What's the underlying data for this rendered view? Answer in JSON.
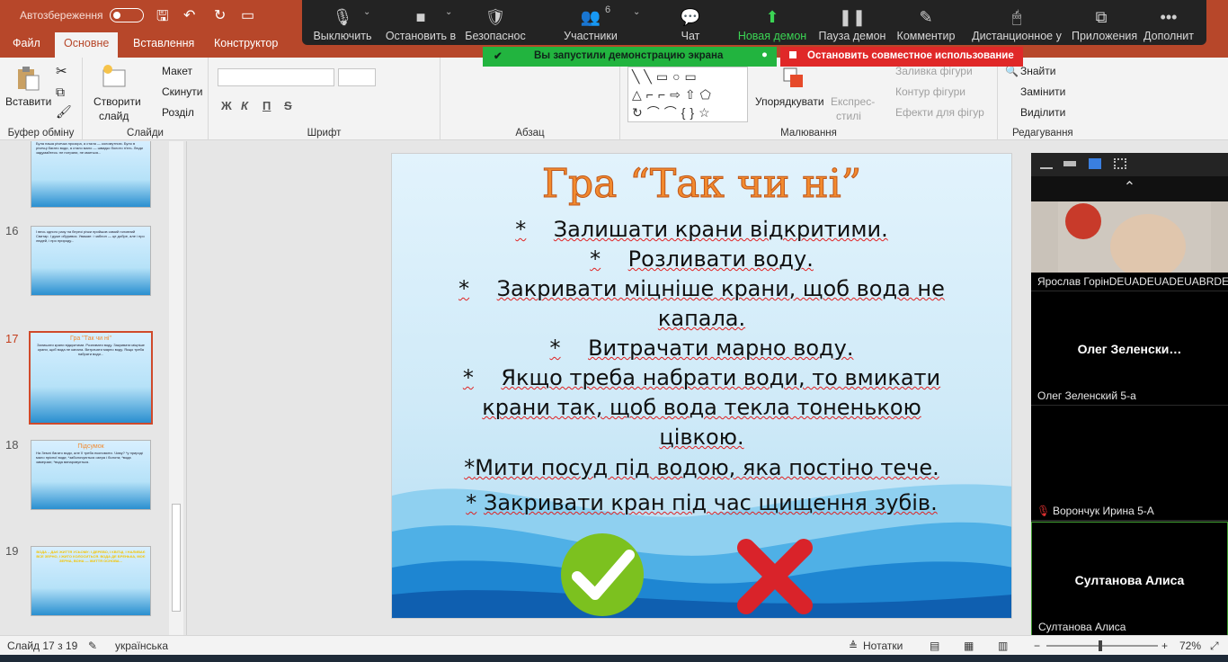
{
  "titlebar": {
    "autosave": "Автозбереження"
  },
  "tabs": [
    "Файл",
    "Основне",
    "Вставлення",
    "Конструктор"
  ],
  "ribbon": {
    "clipboard": {
      "paste": "Вставити",
      "group": "Буфер обміну"
    },
    "slides": {
      "new_slide_1": "Створити",
      "new_slide_2": "слайд",
      "layout": "Макет",
      "reset": "Скинути",
      "section": "Розділ",
      "group": "Слайди"
    },
    "font": {
      "group": "Шрифт",
      "bold": "Ж",
      "italic": "К",
      "underline": "П",
      "strike": "S"
    },
    "paragraph": {
      "group": "Абзац"
    },
    "drawing": {
      "arrange": "Упорядкувати",
      "quick_styles_1": "Експрес-",
      "quick_styles_2": "стилі",
      "shape_fill": "Заливка фігури",
      "shape_outline": "Контур фігури",
      "shape_effects": "Ефекти для фігур",
      "group": "Малювання"
    },
    "editing": {
      "find": "Знайти",
      "replace": "Замінити",
      "select": "Виділити",
      "group": "Редагування"
    }
  },
  "zoom_toolbar": {
    "items": [
      {
        "label": "Выключить",
        "icon": "microphone-icon"
      },
      {
        "label": "Остановить в",
        "icon": "video-camera-icon"
      },
      {
        "label": "Безопаснос",
        "icon": "shield-icon"
      },
      {
        "label": "Участники",
        "icon": "participants-icon",
        "count": "6"
      },
      {
        "label": "Чат",
        "icon": "chat-icon"
      },
      {
        "label": "Новая демон",
        "icon": "share-screen-icon"
      },
      {
        "label": "Пауза демон",
        "icon": "pause-icon"
      },
      {
        "label": "Комментир",
        "icon": "pencil-icon"
      },
      {
        "label": "Дистанционное у",
        "icon": "mouse-icon"
      },
      {
        "label": "Приложения",
        "icon": "apps-icon"
      },
      {
        "label": "Дополнит",
        "icon": "more-icon"
      }
    ],
    "share_banner": "Вы запустили демонстрацию экрана",
    "stop_share": "Остановить совместное использование"
  },
  "thumbnails": [
    {
      "num": "",
      "text": "Була наша річечка прозора, а стала — коломутною. Було в річечці багато води, а стало мало — швидко болото п'єть. Люди задумайтесь: не потрапи, не кмиться..."
    },
    {
      "num": "16",
      "text": "І весь одного разу на березі річки прийшов самий головний Свитар. І дуже обурився. Уважае: і чаблон — це добре, але і про людей, і про природу..."
    },
    {
      "num": "17",
      "title": "Гра \"Так чи ні\"",
      "text": "Залишати крани відкритими. Розливати воду. Закривати міцніше крани, щоб вода не капала. Витрачати марно воду. Якщо треба набрати води..."
    },
    {
      "num": "18",
      "title": "Підсумок",
      "text": "На Землі багато води, але її треба економити. Чому? *у природі мало прісної води; *заболочуються озера і болота; *вода замерзає; *вода випаровується."
    },
    {
      "num": "19",
      "text": "ВОДА – ДАЄ ЖИТТЯ УСЬОМУ: І ДЕРЕВО, І КВІТЦІ, І НАЛИВАЄ ВСЕ ЗЕРНО, І ЖИТО КОЛОСИТЬСЯ. ВОДА ДЕ БРЕНЬКА, МОЄ ЗЕРНА, ВОНА — ЖИТТЯ ОСНОВА..."
    }
  ],
  "slide": {
    "title": "Гра “Так чи ні”",
    "lines": [
      {
        "bullet": "*",
        "text": "Залишати крани відкритими."
      },
      {
        "bullet": "*",
        "text": "Розливати воду."
      },
      {
        "bullet": "*",
        "text": "Закривати міцніше крани, щоб вода не"
      },
      {
        "bullet": "",
        "text": "капала."
      },
      {
        "bullet": "*",
        "text": "Витрачати марно воду."
      },
      {
        "bullet": "*",
        "text": "Якщо треба набрати води, то вмикати"
      },
      {
        "bullet": "",
        "text": "крани так, щоб вода текла тоненькою"
      },
      {
        "bullet": "",
        "text": "цівкою."
      },
      {
        "bullet": "*",
        "text": "Мити посуд під водою, яка постіно тече."
      },
      {
        "bullet": "*",
        "text": "Закривати кран під час щищення зубів."
      }
    ]
  },
  "participants": [
    {
      "name": "Ярослав ГорінDEUADEUADEUABRDEUA❤",
      "video": true
    },
    {
      "center": "Олег  Зеленски…",
      "name": "Олег Зеленский 5-а"
    },
    {
      "center": "",
      "name": "Ворончук Ирина 5-А",
      "muted": true
    },
    {
      "center": "Султанова Алиса",
      "name": "Султанова Алиса"
    }
  ],
  "status": {
    "slide": "Слайд 17 з 19",
    "language": "українська",
    "notes": "Нотатки",
    "zoom": "72%"
  }
}
